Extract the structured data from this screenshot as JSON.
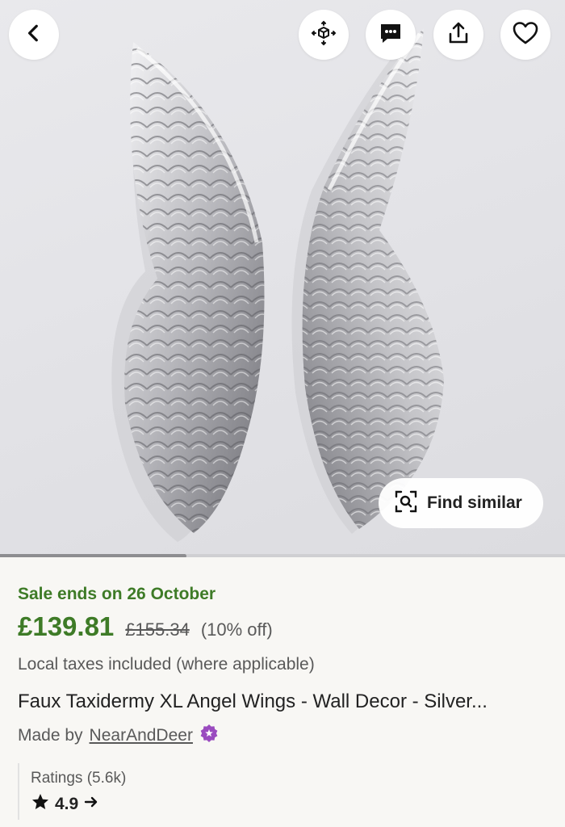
{
  "listing": {
    "sale_text": "Sale ends on 26 October",
    "price": "£139.81",
    "original_price": "£155.34",
    "discount": "(10% off)",
    "taxes_note": "Local taxes included (where applicable)",
    "title": "Faux Taxidermy XL Angel Wings - Wall Decor - Silver...",
    "made_by_prefix": "Made by",
    "shop_name": "NearAndDeer",
    "ratings_label": "Ratings (5.6k)",
    "rating_value": "4.9"
  },
  "image": {
    "find_similar_label": "Find similar",
    "gallery_progress": 0.33
  },
  "icons": {
    "back": "chevron-left-icon",
    "ar": "view-in-room-icon",
    "message": "message-icon",
    "share": "share-icon",
    "favorite": "heart-icon",
    "find_similar": "visual-search-icon",
    "star_seller": "star-seller-badge-icon",
    "star": "star-icon",
    "arrow": "arrow-right-icon"
  },
  "colors": {
    "sale_green": "#3e7b27",
    "star_seller_purple": "#9a4bbf",
    "background": "#f8f7f4"
  }
}
